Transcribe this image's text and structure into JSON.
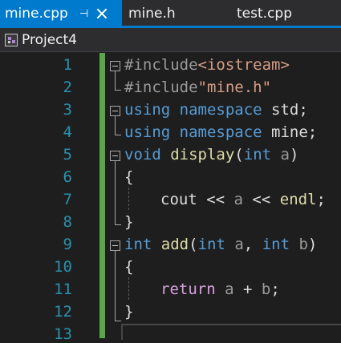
{
  "tabs": [
    {
      "label": "mine.cpp",
      "active": true
    },
    {
      "label": "mine.h",
      "active": false
    },
    {
      "label": "test.cpp",
      "active": false
    }
  ],
  "tab_pin_glyph": "⊣",
  "nav": {
    "project": "Project4",
    "project_icon": "project-icon"
  },
  "line_numbers": [
    "1",
    "2",
    "3",
    "4",
    "5",
    "6",
    "7",
    "8",
    "9",
    "10",
    "11",
    "12",
    "13"
  ],
  "code": {
    "l1": {
      "t1": "#include",
      "t2": "<iostream>"
    },
    "l2": {
      "t1": "#include",
      "t2": "\"mine.h\""
    },
    "l3": {
      "t1": "using",
      "t2": " ",
      "t3": "namespace",
      "t4": " std;"
    },
    "l4": {
      "t1": "using",
      "t2": " ",
      "t3": "namespace",
      "t4": " mine;"
    },
    "l5": {
      "t1": "void",
      "t2": " ",
      "t3": "display",
      "t4": "(",
      "t5": "int",
      "t6": " ",
      "t7": "a",
      "t8": ")"
    },
    "l6": {
      "t1": "{"
    },
    "l7": {
      "t1": "cout",
      "t2": " << ",
      "t3": "a",
      "t4": " << ",
      "t5": "endl",
      "t6": ";"
    },
    "l8": {
      "t1": "}"
    },
    "l9": {
      "t1": "int",
      "t2": " ",
      "t3": "add",
      "t4": "(",
      "t5": "int",
      "t6": " ",
      "t7": "a",
      "t8": ", ",
      "t9": "int",
      "t10": " ",
      "t11": "b",
      "t12": ")"
    },
    "l10": {
      "t1": "{"
    },
    "l11": {
      "t1": "return",
      "t2": " ",
      "t3": "a",
      "t4": " + ",
      "t5": "b",
      "t6": ";"
    },
    "l12": {
      "t1": "}"
    }
  },
  "colors": {
    "accent": "#007acc",
    "keyword": "#569cd6",
    "preprocessor": "#9b9b9b",
    "string": "#d69d85",
    "function": "#dcdcaa",
    "control_keyword": "#d8a0df",
    "line_number": "#2b91af",
    "change_bar": "#57a64a"
  }
}
